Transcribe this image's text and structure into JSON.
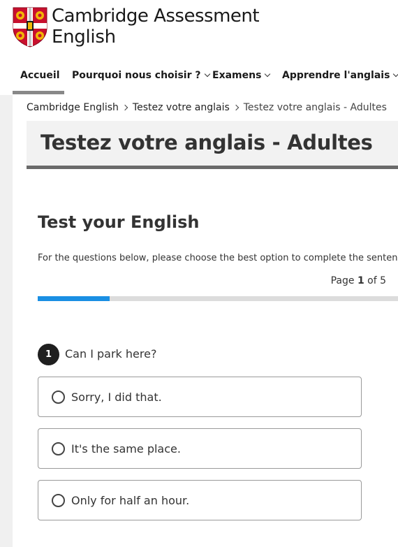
{
  "brand": {
    "line1": "Cambridge Assessment",
    "line2": "English",
    "colors": {
      "shield_red": "#c8102e",
      "shield_gold": "#f2b705",
      "shield_white": "#ffffff"
    }
  },
  "nav": {
    "items": [
      {
        "label": "Accueil",
        "active": true,
        "has_dropdown": false
      },
      {
        "label": "Pourquoi nous choisir ?",
        "active": false,
        "has_dropdown": true
      },
      {
        "label": "Examens",
        "active": false,
        "has_dropdown": true
      },
      {
        "label": "Apprendre l'anglais",
        "active": false,
        "has_dropdown": true
      }
    ]
  },
  "breadcrumb": {
    "items": [
      "Cambridge English",
      "Testez votre anglais",
      "Testez votre anglais - Adultes"
    ]
  },
  "page": {
    "title": "Testez votre anglais - Adultes"
  },
  "test": {
    "heading": "Test your English",
    "instructions": "For the questions below, please choose the best option to complete the sentence or conversation.",
    "page_label": "Page",
    "page_current": "1",
    "page_of": "of 5",
    "progress_fraction": 0.2,
    "progress_color": "#1a8fe3"
  },
  "question": {
    "number": "1",
    "text": "Can I park here?",
    "options": [
      {
        "label": "Sorry, I did that.",
        "selected": false
      },
      {
        "label": "It's the same place.",
        "selected": false
      },
      {
        "label": "Only for half an hour.",
        "selected": false
      }
    ]
  },
  "icons": {
    "nav_dropdown": "chevron-down-icon",
    "breadcrumb_separator": "chevron-right-icon",
    "logo": "cambridge-shield-icon",
    "radio": "radio-unchecked-icon"
  }
}
